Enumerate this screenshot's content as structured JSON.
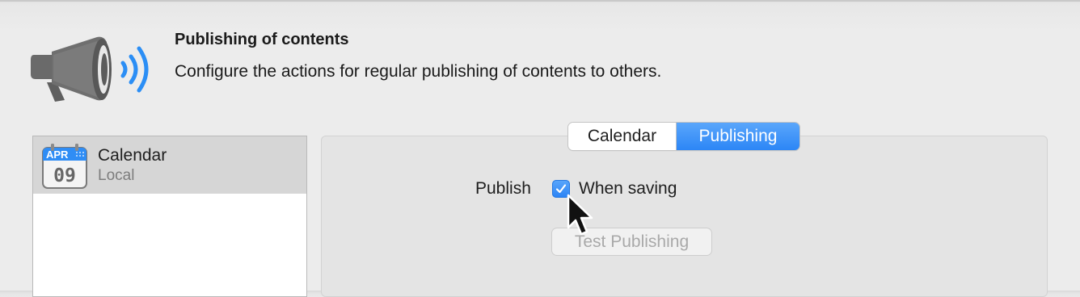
{
  "header": {
    "icon": "megaphone-icon",
    "title": "Publishing of contents",
    "description": "Configure the actions for regular publishing of contents to others."
  },
  "sources": {
    "items": [
      {
        "icon": "calendar-icon",
        "icon_month": "APR",
        "icon_day": "09",
        "name": "Calendar",
        "subtitle": "Local",
        "selected": true
      }
    ]
  },
  "tabs": [
    {
      "label": "Calendar",
      "selected": false
    },
    {
      "label": "Publishing",
      "selected": true
    }
  ],
  "publishing": {
    "publish_label": "Publish",
    "when_saving_label": "When saving",
    "when_saving_checked": true,
    "test_button_label": "Test Publishing",
    "test_button_enabled": false
  },
  "colors": {
    "accent": "#2c86f6",
    "icon_gray": "#6b6b6b",
    "wave_blue": "#2b8ef5"
  },
  "cursor": "arrow-cursor-icon"
}
